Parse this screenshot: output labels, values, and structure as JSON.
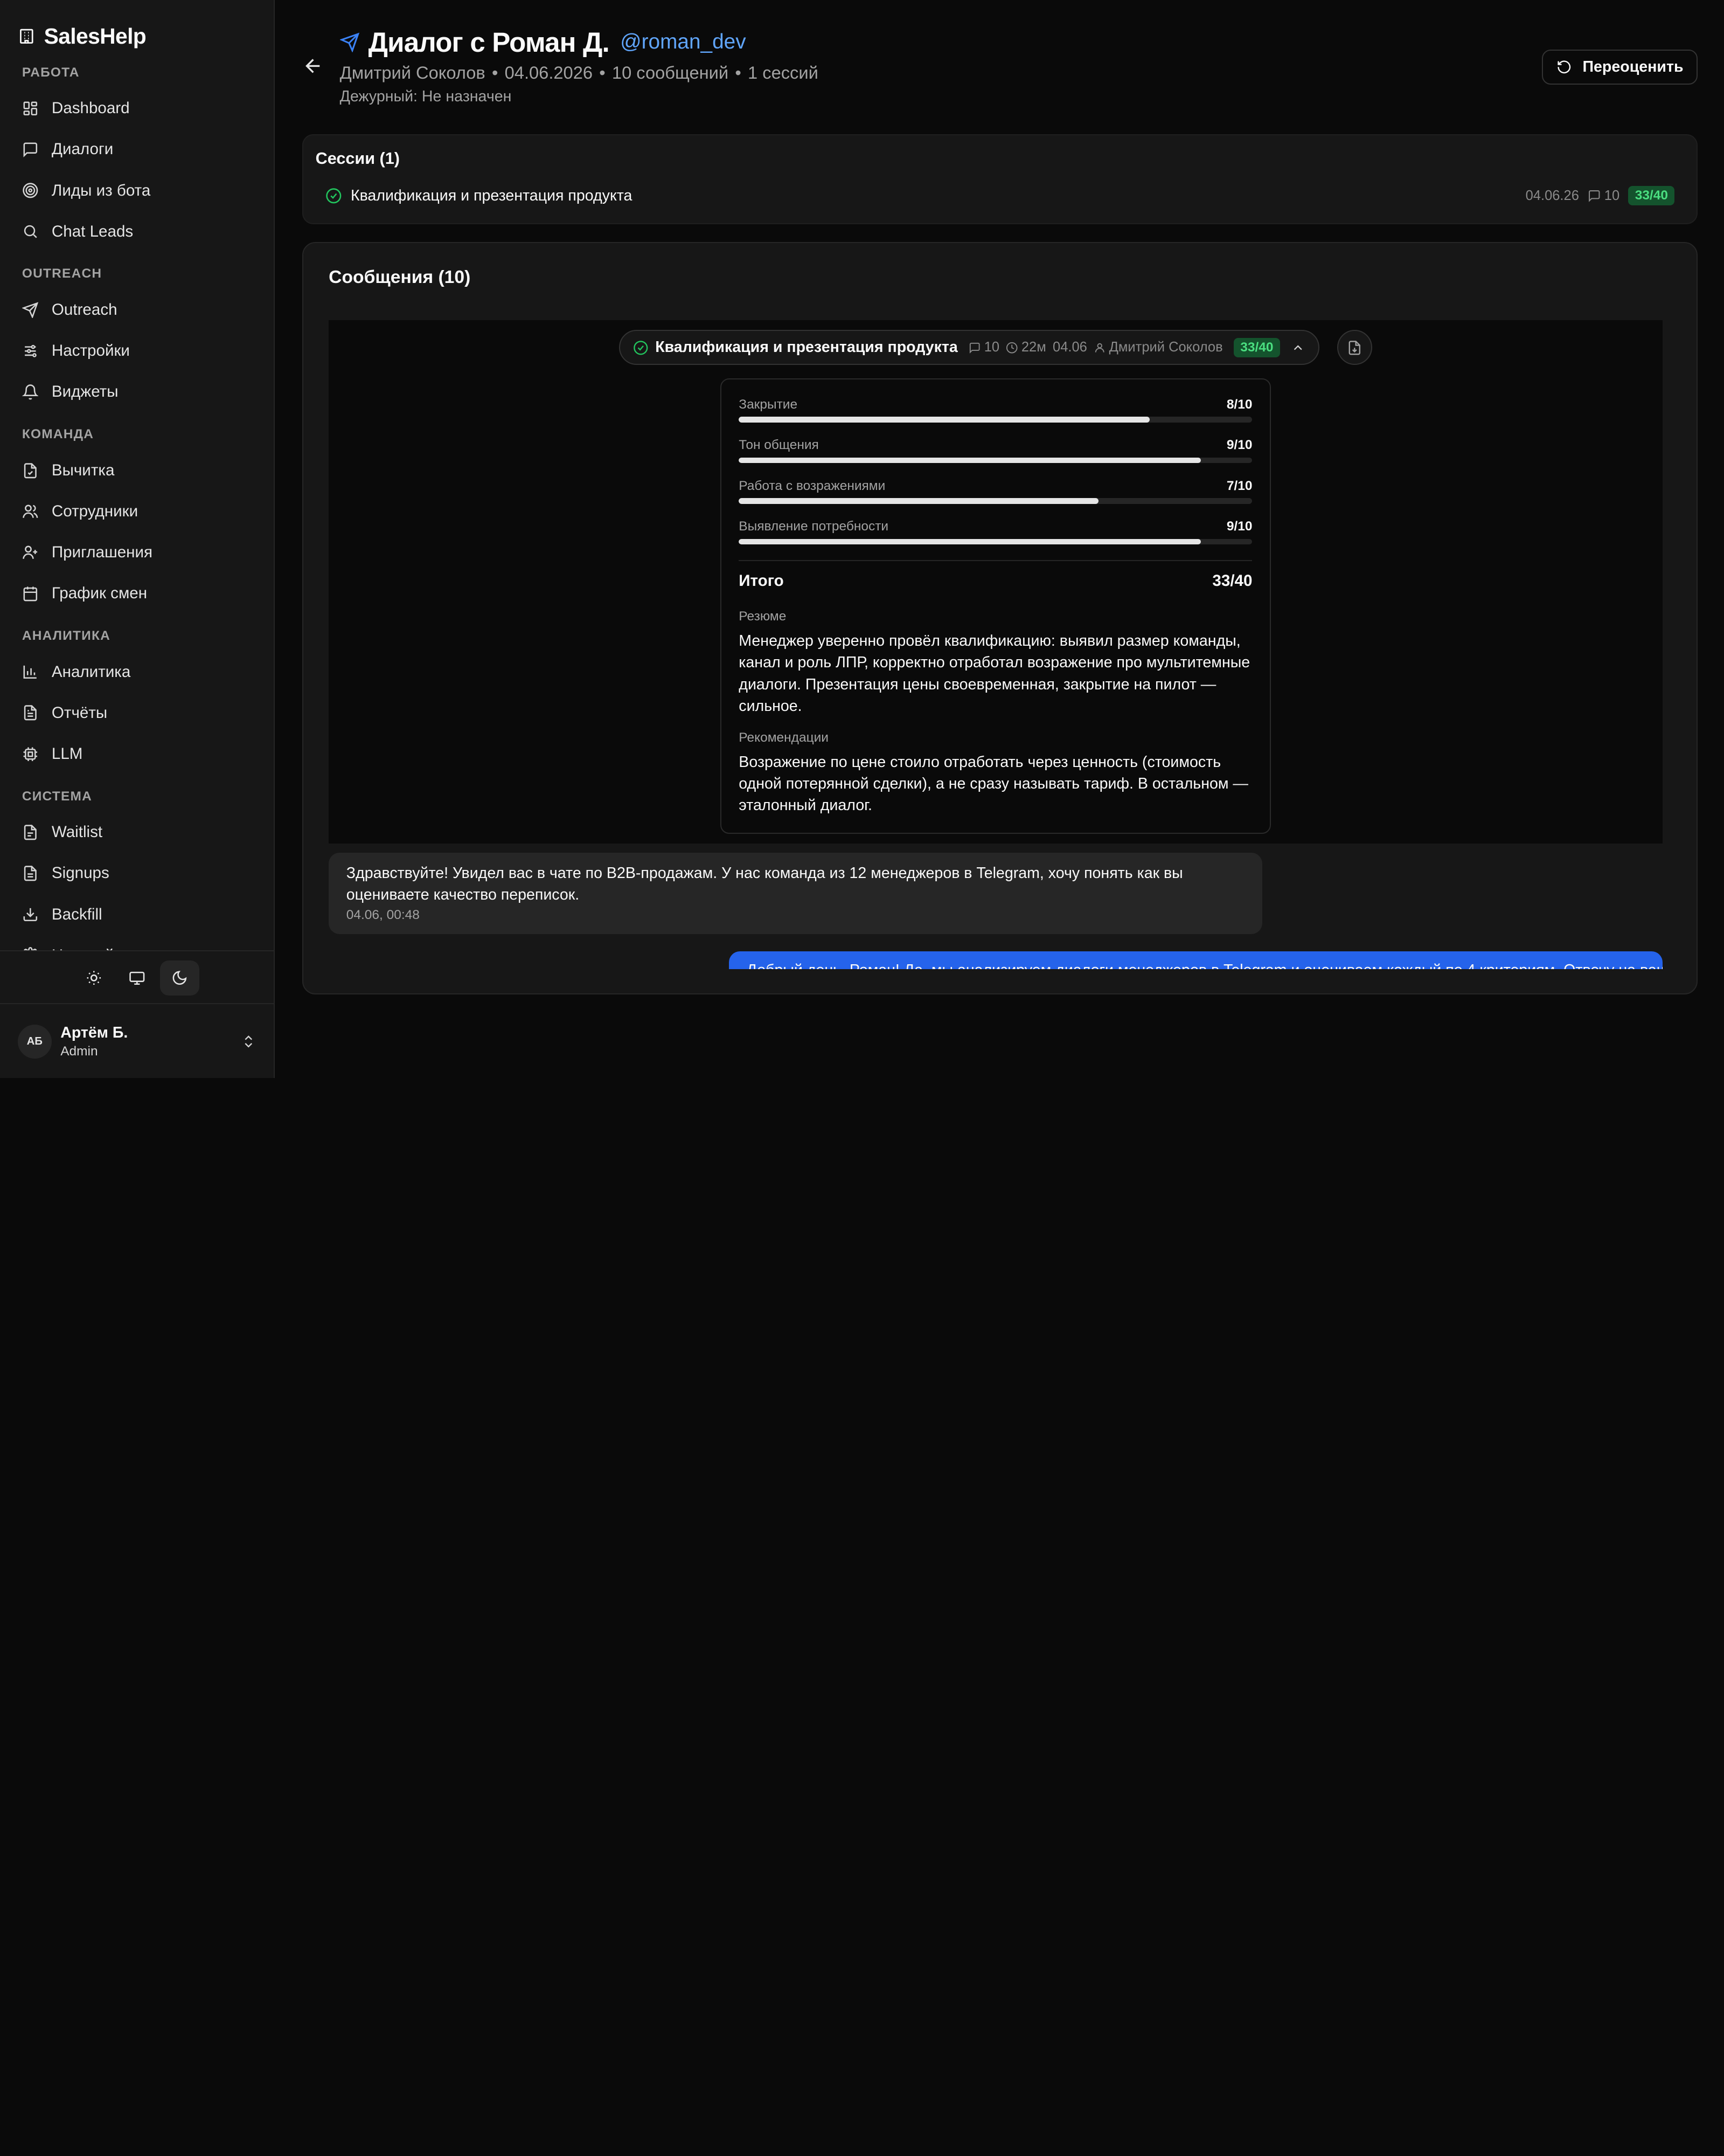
{
  "brand": {
    "name": "SalesHelp",
    "icon": "building-icon"
  },
  "nav_groups": [
    {
      "label": "РАБОТА",
      "items": [
        {
          "label": "Dashboard",
          "icon": "dashboard-icon"
        },
        {
          "label": "Диалоги",
          "icon": "chat-icon"
        },
        {
          "label": "Лиды из бота",
          "icon": "target-icon"
        },
        {
          "label": "Chat Leads",
          "icon": "search-icon"
        }
      ]
    },
    {
      "label": "OUTREACH",
      "items": [
        {
          "label": "Outreach",
          "icon": "send-icon"
        },
        {
          "label": "Настройки",
          "icon": "sliders-icon"
        },
        {
          "label": "Виджеты",
          "icon": "bell-icon"
        }
      ]
    },
    {
      "label": "КОМАНДА",
      "items": [
        {
          "label": "Вычитка",
          "icon": "file-check-icon"
        },
        {
          "label": "Сотрудники",
          "icon": "users-icon"
        },
        {
          "label": "Приглашения",
          "icon": "user-plus-icon"
        },
        {
          "label": "График смен",
          "icon": "calendar-icon"
        }
      ]
    },
    {
      "label": "АНАЛИТИКА",
      "items": [
        {
          "label": "Аналитика",
          "icon": "bar-chart-icon"
        },
        {
          "label": "Отчёты",
          "icon": "file-text-icon"
        },
        {
          "label": "LLM",
          "icon": "cpu-icon"
        }
      ]
    },
    {
      "label": "СИСТЕМА",
      "items": [
        {
          "label": "Waitlist",
          "icon": "clipboard-icon"
        },
        {
          "label": "Signups",
          "icon": "clipboard-list-icon"
        },
        {
          "label": "Backfill",
          "icon": "download-icon"
        },
        {
          "label": "Настройки",
          "icon": "settings-icon"
        }
      ]
    }
  ],
  "theme": {
    "options": [
      "light",
      "system",
      "dark"
    ],
    "selected": "dark"
  },
  "user": {
    "initials": "АБ",
    "name": "Артём Б.",
    "role": "Admin"
  },
  "header": {
    "title": "Диалог с Роман Д.",
    "handle": "@roman_dev",
    "subtitle_parts": [
      "Дмитрий Соколов",
      "•",
      "04.06.2026",
      "•",
      "10 сообщений",
      "•",
      "1 сессий"
    ],
    "duty": "Дежурный: Не назначен",
    "reeval_label": "Переоценить"
  },
  "sessions": {
    "title": "Сессии (1)",
    "rows": [
      {
        "name": "Квалификация и презентация продукта",
        "date": "04.06.26",
        "messages": "10",
        "score": "33/40"
      }
    ]
  },
  "messages": {
    "title": "Сообщения (10)",
    "session_pill": {
      "name": "Квалификация и презентация продукта",
      "messages": "10",
      "duration": "22м",
      "date": "04.06",
      "manager": "Дмитрий Соколов",
      "score": "33/40"
    },
    "scorecard": {
      "criteria": [
        {
          "label": "Закрытие",
          "score": "8/10",
          "value": 8,
          "max": 10
        },
        {
          "label": "Тон общения",
          "score": "9/10",
          "value": 9,
          "max": 10
        },
        {
          "label": "Работа с возражениями",
          "score": "7/10",
          "value": 7,
          "max": 10
        },
        {
          "label": "Выявление потребности",
          "score": "9/10",
          "value": 9,
          "max": 10
        }
      ],
      "total_label": "Итого",
      "total_score": "33/40",
      "summary_label": "Резюме",
      "summary": "Менеджер уверенно провёл квалификацию: выявил размер команды, канал и роль ЛПР, корректно отработал возражение про мультитемные диалоги. Презентация цены своевременная, закрытие на пилот — сильное.",
      "reco_label": "Рекомендации",
      "reco": "Возражение по цене стоило отработать через ценность (стоимость одной потерянной сделки), а не сразу называть тариф. В остальном — эталонный диалог."
    },
    "incoming": {
      "text": "Здравствуйте! Увидел вас в чате по B2B-продажам. У нас команда из 12 менеджеров в Telegram, хочу понять как вы оцениваете качество переписок.",
      "time": "04.06, 00:48"
    },
    "outgoing": {
      "text": "Добрый день, Роман! Да, мы анализируем диалоги менеджеров в Telegram и оцениваем каждый по 4 критериям. Отвечу на ваши вопросы."
    }
  },
  "colors": {
    "background": "#0a0a0a",
    "sidebar": "#171717",
    "accent_blue": "#2563eb",
    "link_blue": "#60a5fa",
    "success_green": "#22c55e",
    "score_badge_bg": "#14532d"
  }
}
